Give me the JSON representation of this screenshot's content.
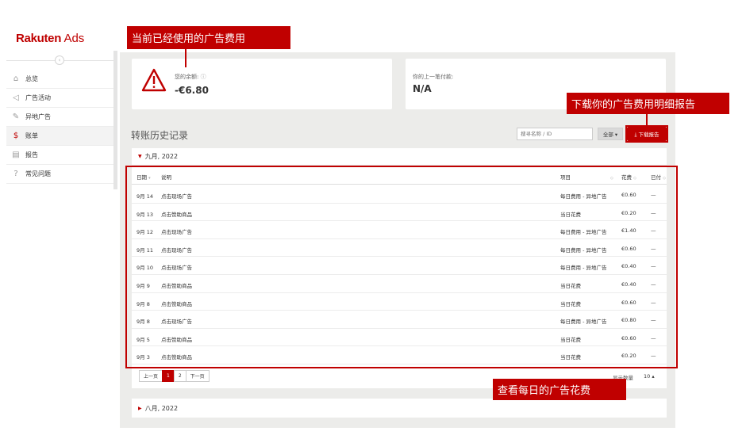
{
  "logo": {
    "brand": "Rakuten",
    "product": "Ads"
  },
  "sidebar": {
    "items": [
      {
        "icon": "home-icon",
        "glyph": "⌂",
        "label": "总览",
        "active": false
      },
      {
        "icon": "megaphone-icon",
        "glyph": "📢",
        "label": "广告活动",
        "active": false
      },
      {
        "icon": "external-edit-icon",
        "glyph": "✎",
        "label": "异地广告",
        "active": false
      },
      {
        "icon": "dollar-icon",
        "glyph": "$",
        "label": "账单",
        "active": true
      },
      {
        "icon": "report-icon",
        "glyph": "▤",
        "label": "报告",
        "active": false
      },
      {
        "icon": "question-icon",
        "glyph": "?",
        "label": "常见问题",
        "active": false
      }
    ]
  },
  "balance": {
    "label": "您的余额:",
    "value": "-€6.80"
  },
  "last_payment": {
    "label": "你的上一笔付款:",
    "value": "N/A"
  },
  "history": {
    "title": "转账历史记录",
    "search_placeholder": "搜寻名称 / ID",
    "filter_label": "全部 ▾",
    "download_label": "⤓ 下载报告"
  },
  "month": {
    "label": "九月, 2022",
    "columns": {
      "date": "日期",
      "desc": "说明",
      "item": "项目",
      "cost": "花费",
      "paid": "已付"
    },
    "rows": [
      {
        "date": "9月 14",
        "desc": "点击现场广告",
        "item": "每日费用 - 异地广告",
        "cost": "€0.60",
        "paid": "—"
      },
      {
        "date": "9月 13",
        "desc": "点击赞助商品",
        "item": "当日花费",
        "cost": "€0.20",
        "paid": "—"
      },
      {
        "date": "9月 12",
        "desc": "点击现场广告",
        "item": "每日费用 - 异地广告",
        "cost": "€1.40",
        "paid": "—"
      },
      {
        "date": "9月 11",
        "desc": "点击现场广告",
        "item": "每日费用 - 异地广告",
        "cost": "€0.60",
        "paid": "—"
      },
      {
        "date": "9月 10",
        "desc": "点击现场广告",
        "item": "每日费用 - 异地广告",
        "cost": "€0.40",
        "paid": "—"
      },
      {
        "date": "9月 9",
        "desc": "点击赞助商品",
        "item": "当日花费",
        "cost": "€0.40",
        "paid": "—"
      },
      {
        "date": "9月 8",
        "desc": "点击赞助商品",
        "item": "当日花费",
        "cost": "€0.60",
        "paid": "—"
      },
      {
        "date": "9月 8",
        "desc": "点击现场广告",
        "item": "每日费用 - 异地广告",
        "cost": "€0.80",
        "paid": "—"
      },
      {
        "date": "9月 5",
        "desc": "点击赞助商品",
        "item": "当日花费",
        "cost": "€0.60",
        "paid": "—"
      },
      {
        "date": "9月 3",
        "desc": "点击赞助商品",
        "item": "当日花费",
        "cost": "€0.20",
        "paid": "—"
      }
    ],
    "pagination": {
      "prev": "上一页",
      "pages": [
        "1",
        "2"
      ],
      "current": "1",
      "next": "下一页"
    },
    "per_page_label": "显示数量",
    "per_page_value": "10 ▴"
  },
  "august": {
    "label": "八月, 2022"
  },
  "annotations": {
    "balance": "当前已经使用的广告费用",
    "download": "下载你的广告费用明细报告",
    "daily": "查看每日的广告花费"
  },
  "colors": {
    "brand": "#bf0000",
    "annotation": "#c00000"
  }
}
